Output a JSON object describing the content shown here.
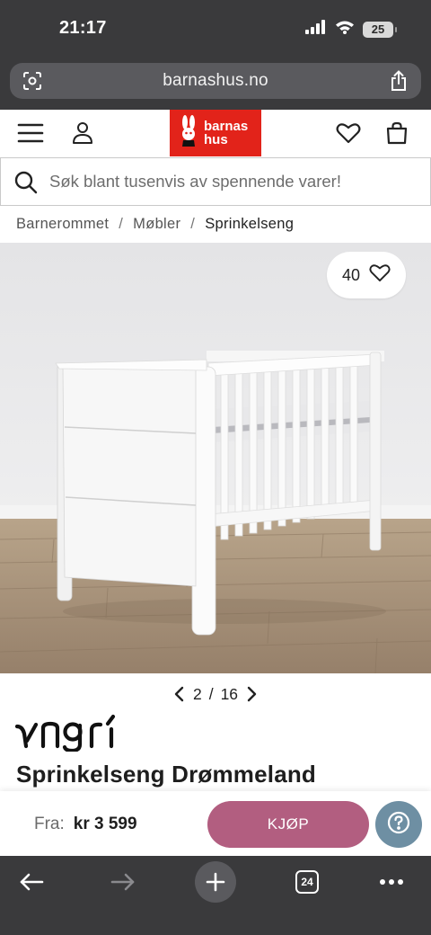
{
  "status_bar": {
    "time": "21:17",
    "battery": "25"
  },
  "browser": {
    "url": "barnashus.no",
    "tabs_count": "24"
  },
  "header": {
    "logo_line1": "barnas",
    "logo_line2": "hus",
    "brand_color": "#e2231a"
  },
  "search": {
    "placeholder": "Søk blant tusenvis av spennende varer!"
  },
  "breadcrumb": {
    "items": [
      "Barnerommet",
      "Møbler",
      "Sprinkelseng"
    ],
    "separator": "/"
  },
  "gallery": {
    "favorites_count": "40",
    "current": "2",
    "separator": "/",
    "total": "16"
  },
  "product": {
    "brand": "Yngri",
    "title": "Sprinkelseng Drømmeland"
  },
  "buy_bar": {
    "price_label": "Fra:",
    "price": "kr 3 599",
    "buy_label": "KJØP",
    "buy_color": "#b25e80",
    "help_color": "#6e8fa3"
  }
}
